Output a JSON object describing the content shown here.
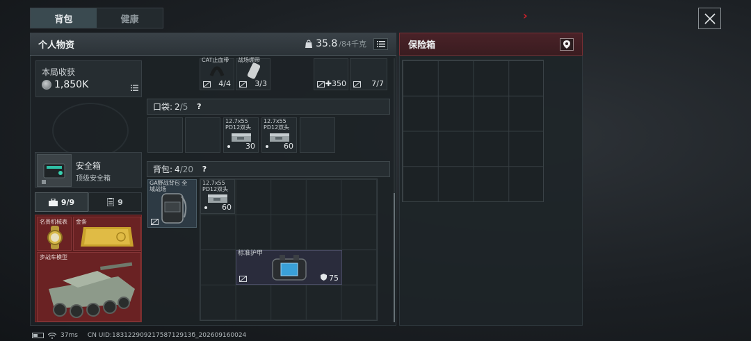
{
  "tabs": [
    {
      "label": "背包",
      "active": true
    },
    {
      "label": "健康",
      "active": false
    }
  ],
  "personal": {
    "title": "个人物资",
    "weight_current": "35.8",
    "weight_max": "/84千克"
  },
  "earnings": {
    "label": "本局收获",
    "value": "1,850K"
  },
  "safebox": {
    "name": "安全箱",
    "subtitle": "顶级安全箱"
  },
  "capacity_tabs": [
    {
      "value": "9/9",
      "icon": "briefcase-icon",
      "active": true
    },
    {
      "value": "9",
      "icon": "clipboard-icon",
      "active": false
    }
  ],
  "valuables": [
    {
      "label": "名贵机械表"
    },
    {
      "label": "金条"
    },
    {
      "label": "步战车模型"
    }
  ],
  "top_items": [
    {
      "label": "CAT止血带",
      "count": "4/4"
    },
    {
      "label": "战场绷带",
      "count": "3/3"
    },
    {
      "label": "",
      "count": "350"
    },
    {
      "label": "",
      "count": "7/7"
    }
  ],
  "pockets": {
    "label": "口袋:",
    "used": "2",
    "total": "/5",
    "help": "?",
    "items": [
      {
        "label": "12.7x55 PD12双头",
        "count": "30"
      },
      {
        "label": "12.7x55 PD12双头",
        "count": "60"
      }
    ]
  },
  "backpack": {
    "label": "背包:",
    "used": "4",
    "total": "/20",
    "help": "?",
    "bag_item": "GA野战背包 全域战场",
    "ammo": {
      "label": "12.7x55 PD12双头",
      "count": "60"
    },
    "armor": {
      "label": "标准护甲",
      "durability": "75"
    }
  },
  "insurance": {
    "title": "保险箱"
  },
  "status_bar": {
    "ping": "37ms",
    "uid": "CN UID:18312290921758712913б_202609160024"
  },
  "colors": {
    "accent_red": "#d6202a",
    "valuables_bg": "#5c1d1e",
    "insurance_header": "#4a2228"
  }
}
